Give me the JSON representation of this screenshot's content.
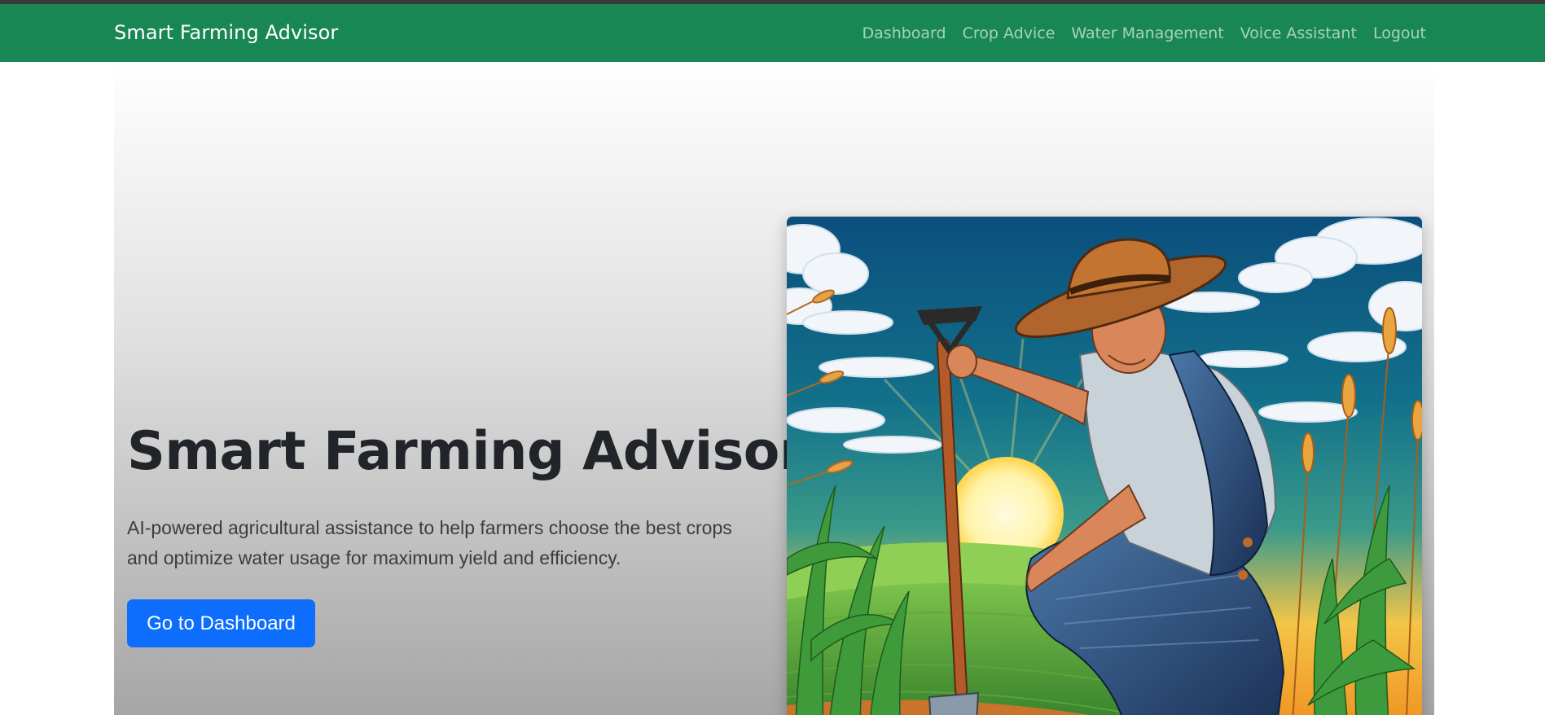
{
  "app": {
    "brand": "Smart Farming Advisor"
  },
  "nav": {
    "items": [
      {
        "label": "Dashboard"
      },
      {
        "label": "Crop Advice"
      },
      {
        "label": "Water Management"
      },
      {
        "label": "Voice Assistant"
      },
      {
        "label": "Logout"
      }
    ]
  },
  "hero": {
    "title": "Smart Farming Advisor",
    "lead": "AI-powered agricultural assistance to help farmers choose the best crops and optimize water usage for maximum yield and efficiency.",
    "cta_label": "Go to Dashboard",
    "image_icon": "farmer-illustration"
  },
  "colors": {
    "navbar": "#198754",
    "primary_button": "#0d6efd",
    "title_text": "#212529"
  }
}
